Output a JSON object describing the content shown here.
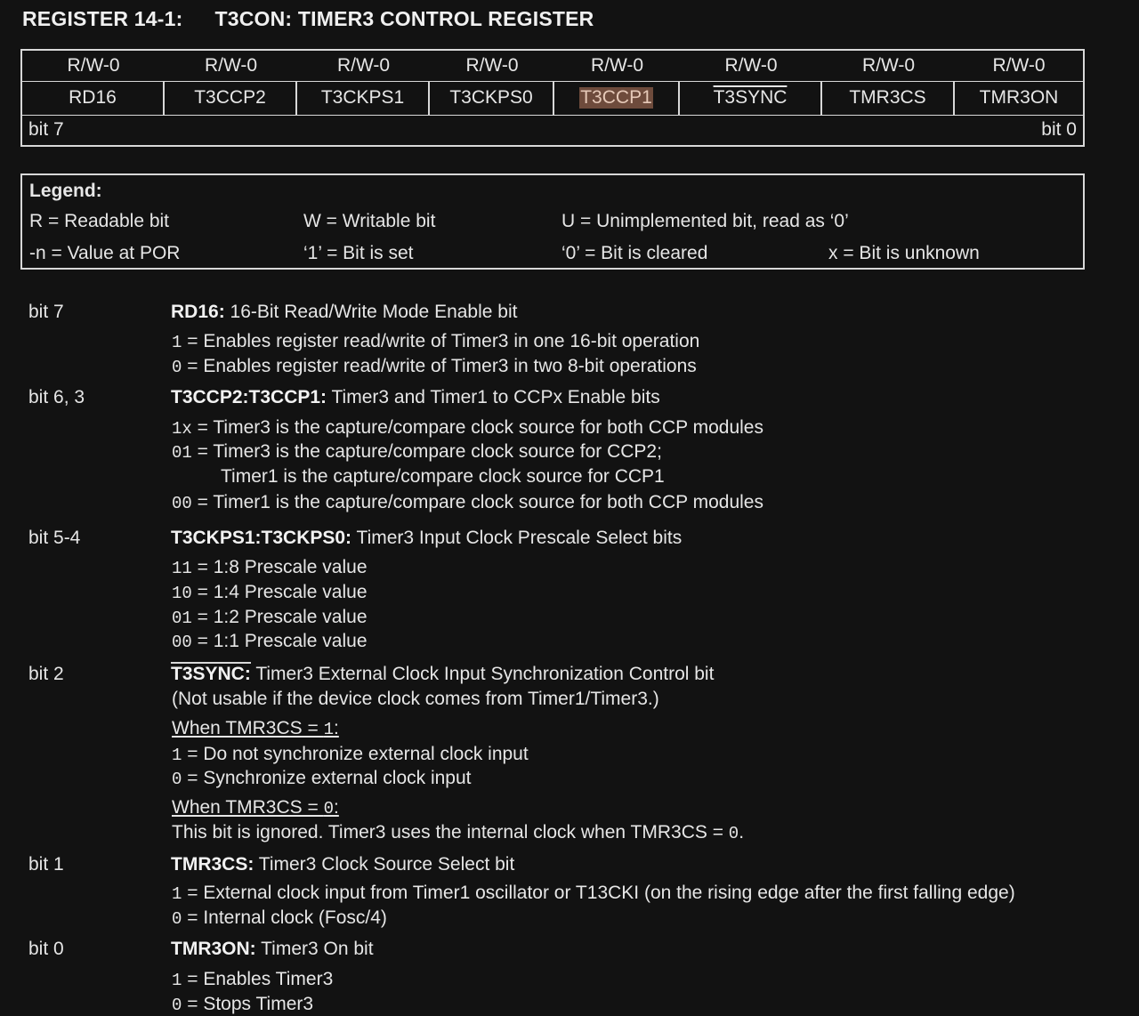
{
  "title": {
    "number": "REGISTER 14-1:",
    "name": "T3CON: TIMER3 CONTROL REGISTER"
  },
  "register": {
    "access": [
      "R/W-0",
      "R/W-0",
      "R/W-0",
      "R/W-0",
      "R/W-0",
      "R/W-0",
      "R/W-0",
      "R/W-0"
    ],
    "bits": [
      "RD16",
      "T3CCP2",
      "T3CKPS1",
      "T3CKPS0",
      "T3CCP1",
      "T3SYNC",
      "TMR3CS",
      "TMR3ON"
    ],
    "bit_high": "bit 7",
    "bit_low": "bit 0"
  },
  "legend": {
    "title": "Legend:",
    "r": "R = Readable bit",
    "w": "W = Writable bit",
    "u": "U = Unimplemented bit, read as ‘0’",
    "n": "-n = Value at POR",
    "set": "‘1’ = Bit is set",
    "cleared": "‘0’ = Bit is cleared",
    "unknown": "x = Bit is unknown"
  },
  "desc": {
    "b7": {
      "label": "bit 7",
      "name": "RD16:",
      "title": " 16-Bit Read/Write Mode Enable bit",
      "o1_code": "1",
      "o1_text": " =  Enables register read/write of Timer3 in one 16-bit operation",
      "o0_code": "0",
      "o0_text": " =  Enables register read/write of Timer3 in two 8-bit operations"
    },
    "b63": {
      "label": "bit 6, 3",
      "name": "T3CCP2:T3CCP1:",
      "title": " Timer3 and Timer1 to CCPx Enable bits",
      "o1_code": "1x",
      "o1_text": " = Timer3 is the capture/compare clock source for both CCP modules",
      "o2_code": "01",
      "o2_text": " = Timer3 is the capture/compare clock source for CCP2;",
      "o2_cont": "Timer1 is the capture/compare clock source for CCP1",
      "o3_code": "00",
      "o3_text": " = Timer1 is the capture/compare clock source for both CCP modules"
    },
    "b54": {
      "label": "bit 5-4",
      "name": "T3CKPS1:T3CKPS0:",
      "title": " Timer3 Input Clock Prescale Select bits",
      "o1_code": "11",
      "o1_text": " = 1:8 Prescale value",
      "o2_code": "10",
      "o2_text": " = 1:4 Prescale value",
      "o3_code": "01",
      "o3_text": " = 1:2 Prescale value",
      "o4_code": "00",
      "o4_text": " = 1:1 Prescale value"
    },
    "b2": {
      "label": "bit 2",
      "name": "T3SYNC:",
      "title": " Timer3 External Clock Input Synchronization Control bit",
      "note": "(Not usable if the device clock comes from Timer1/Timer3.)",
      "when1_text": "When TMR3CS = ",
      "when1_code": "1",
      "when1_end": ":",
      "o1_code": "1",
      "o1_text": " = Do not synchronize external clock input",
      "o0_code": "0",
      "o0_text": " = Synchronize external clock input",
      "when0_text": "When TMR3CS = ",
      "when0_code": "0",
      "when0_end": ":",
      "ignored_text": "This bit is ignored. Timer3 uses the internal clock when TMR3CS = ",
      "ignored_code": "0",
      "ignored_end": "."
    },
    "b1": {
      "label": "bit 1",
      "name": "TMR3CS:",
      "title": " Timer3 Clock Source Select bit",
      "o1_code": "1",
      "o1_text": " =  External clock input from Timer1 oscillator or T13CKI (on the rising edge after the first falling edge)",
      "o0_code": "0",
      "o0_text": " =  Internal clock (Fosc/4)"
    },
    "b0": {
      "label": "bit 0",
      "name": "TMR3ON:",
      "title": " Timer3 On bit",
      "o1_code": "1",
      "o1_text": " =  Enables Timer3",
      "o0_code": "0",
      "o0_text": " =  Stops Timer3"
    }
  }
}
